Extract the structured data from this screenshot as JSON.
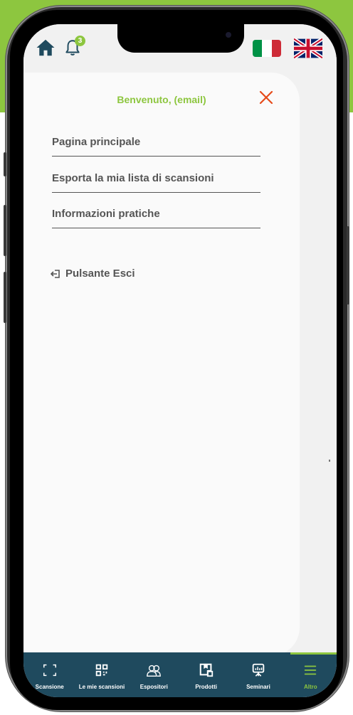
{
  "colors": {
    "accent": "#8dc63f",
    "close": "#e64a19",
    "text": "#555555",
    "tab_bar": "#1f4a5e",
    "home_icon": "#1f4a5e"
  },
  "status_bar": {
    "notification_count": "3",
    "icons": [
      "home-icon",
      "bell-icon",
      "italian-flag-icon",
      "uk-flag-icon"
    ]
  },
  "menu": {
    "welcome": "Benvenuto, (email)",
    "items": [
      {
        "label": "Pagina principale"
      },
      {
        "label": "Esporta la mia lista di scansioni"
      },
      {
        "label": "Informazioni pratiche"
      }
    ],
    "logout_label": "Pulsante Esci"
  },
  "tabs": [
    {
      "label": "Scansione",
      "icon": "scan-icon",
      "active": false
    },
    {
      "label": "Le mie scansioni",
      "icon": "qr-code-icon",
      "active": false
    },
    {
      "label": "Espositori",
      "icon": "users-icon",
      "active": false
    },
    {
      "label": "Prodotti",
      "icon": "product-icon",
      "active": false
    },
    {
      "label": "Seminari",
      "icon": "presentation-icon",
      "active": false
    },
    {
      "label": "Altro",
      "icon": "menu-icon",
      "active": true
    }
  ]
}
